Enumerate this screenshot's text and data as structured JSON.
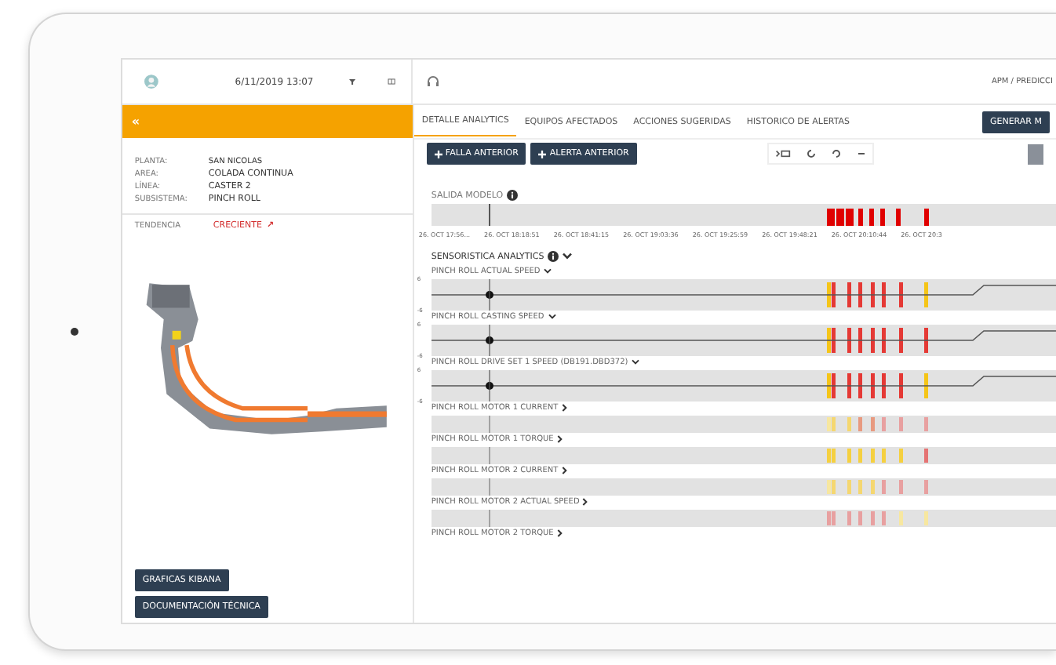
{
  "topbar": {
    "datetime": "6/11/2019 13:07",
    "breadcrumb": "APM / PREDICCI"
  },
  "tabs": [
    {
      "label": "DETALLE ANALYTICS",
      "selected": true
    },
    {
      "label": "EQUIPOS AFECTADOS",
      "selected": false
    },
    {
      "label": "ACCIONES SUGERIDAS",
      "selected": false
    },
    {
      "label": "HISTORICO DE ALERTAS",
      "selected": false
    }
  ],
  "generate_button": "GENERAR M",
  "collapse_icon": "«",
  "details": [
    {
      "label": "PLANTA:",
      "value": "SAN NICOLAS"
    },
    {
      "label": "AREA:",
      "value": "COLADA CONTINUA"
    },
    {
      "label": "LÍNEA:",
      "value": "CASTER 2"
    },
    {
      "label": "SUBSISTEMA:",
      "value": "PINCH ROLL"
    }
  ],
  "trend": {
    "label": "TENDENCIA",
    "value": "CRECIENTE",
    "arrow": "↗"
  },
  "side_buttons": [
    "GRAFICAS KIBANA",
    "DOCUMENTACIÓN TÉCNICA"
  ],
  "nav_buttons": [
    "FALLA ANTERIOR",
    "ALERTA ANTERIOR"
  ],
  "model_output": {
    "title": "SALIDA MODELO",
    "marks": [
      {
        "color": "#e00000"
      },
      {
        "color": "#e00000"
      },
      {
        "color": "#e00000"
      },
      {
        "color": "#e00000"
      },
      {
        "color": "#e00000"
      },
      {
        "color": "#e00000"
      },
      {
        "color": "#e00000"
      },
      {
        "color": "#e00000"
      }
    ],
    "times": [
      "26. OCT 17:56...",
      "26. OCT 18:18:51",
      "26. OCT 18:41:15",
      "26. OCT 19:03:36",
      "26. OCT 19:25:59",
      "26. OCT 19:48:21",
      "26. OCT 20:10:44",
      "26. OCT 20:3"
    ]
  },
  "sensors": {
    "title": "SENSORISTICA ANALYTICS",
    "rows": [
      {
        "name": "PINCH ROLL ACTUAL SPEED",
        "expanded": true,
        "ymax": "6",
        "ymin": "-6",
        "marks": [
          {
            "color": "#f5c518"
          },
          {
            "color": "#e53935"
          },
          {
            "color": "#e53935"
          },
          {
            "color": "#e53935"
          },
          {
            "color": "#e53935"
          },
          {
            "color": "#e53935"
          },
          {
            "color": "#e53935"
          },
          {
            "color": "#f5c518"
          }
        ]
      },
      {
        "name": "PINCH ROLL CASTING SPEED",
        "expanded": true,
        "ymax": "6",
        "ymin": "-6",
        "marks": [
          {
            "color": "#f5c518"
          },
          {
            "color": "#e53935"
          },
          {
            "color": "#e53935"
          },
          {
            "color": "#e53935"
          },
          {
            "color": "#e53935"
          },
          {
            "color": "#e53935"
          },
          {
            "color": "#e53935"
          },
          {
            "color": "#e53935"
          }
        ]
      },
      {
        "name": "PINCH ROLL DRIVE SET 1 SPEED (DB191.DBD372)",
        "expanded": true,
        "ymax": "6",
        "ymin": "-6",
        "marks": [
          {
            "color": "#f5c518"
          },
          {
            "color": "#e53935"
          },
          {
            "color": "#e53935"
          },
          {
            "color": "#e53935"
          },
          {
            "color": "#e53935"
          },
          {
            "color": "#e53935"
          },
          {
            "color": "#e53935"
          },
          {
            "color": "#f5c518"
          }
        ]
      },
      {
        "name": "PINCH ROLL MOTOR 1 CURRENT",
        "expanded": false,
        "marks": [
          {
            "color": "#f7e7a0"
          },
          {
            "color": "#f5d770"
          },
          {
            "color": "#f5d770"
          },
          {
            "color": "#e89a80"
          },
          {
            "color": "#e89a80"
          },
          {
            "color": "#e8a0a0"
          },
          {
            "color": "#e8a0a0"
          },
          {
            "color": "#e8a0a0"
          }
        ]
      },
      {
        "name": "PINCH ROLL MOTOR 1 TORQUE",
        "expanded": false,
        "marks": [
          {
            "color": "#f5d040"
          },
          {
            "color": "#f5d040"
          },
          {
            "color": "#f5d040"
          },
          {
            "color": "#f5d040"
          },
          {
            "color": "#f5d040"
          },
          {
            "color": "#f5d040"
          },
          {
            "color": "#f5d040"
          },
          {
            "color": "#e57373"
          }
        ]
      },
      {
        "name": "PINCH ROLL MOTOR 2 CURRENT",
        "expanded": false,
        "marks": [
          {
            "color": "#f7e7a0"
          },
          {
            "color": "#f5d770"
          },
          {
            "color": "#f5d770"
          },
          {
            "color": "#f5d770"
          },
          {
            "color": "#f5d770"
          },
          {
            "color": "#e8a0a0"
          },
          {
            "color": "#e8a0a0"
          },
          {
            "color": "#e8a0a0"
          }
        ]
      },
      {
        "name": "PINCH ROLL MOTOR 2 ACTUAL SPEED",
        "expanded": false,
        "marks": [
          {
            "color": "#e8a0a0"
          },
          {
            "color": "#e8a0a0"
          },
          {
            "color": "#e8a0a0"
          },
          {
            "color": "#e8a0a0"
          },
          {
            "color": "#e8a0a0"
          },
          {
            "color": "#e8a0a0"
          },
          {
            "color": "#f7e7a0"
          },
          {
            "color": "#f7e7a0"
          }
        ]
      },
      {
        "name": "PINCH ROLL MOTOR 2 TORQUE",
        "expanded": false,
        "marks": []
      }
    ]
  }
}
